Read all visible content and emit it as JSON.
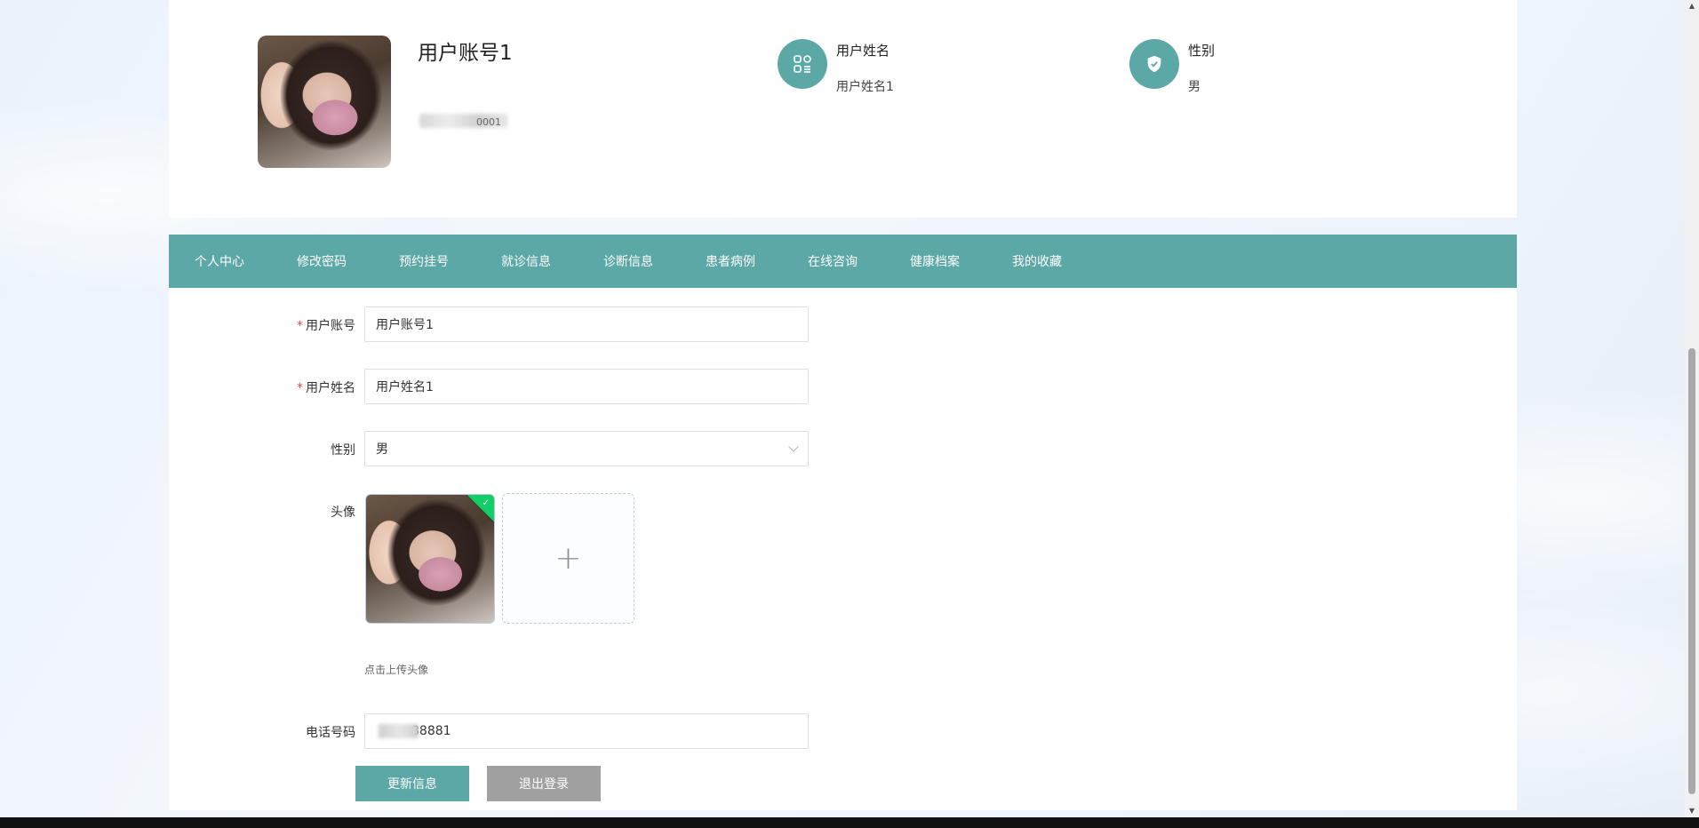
{
  "profile": {
    "account": "用户账号1",
    "phone_masked_tail": "0001",
    "info": [
      {
        "label": "用户姓名",
        "value": "用户姓名1",
        "icon": "user-card-icon"
      },
      {
        "label": "性别",
        "value": "男",
        "icon": "shield-check-icon"
      }
    ]
  },
  "tabs": [
    "个人中心",
    "修改密码",
    "预约挂号",
    "就诊信息",
    "诊断信息",
    "患者病例",
    "在线咨询",
    "健康档案",
    "我的收藏"
  ],
  "form": {
    "account_label": "用户账号",
    "account_value": "用户账号1",
    "name_label": "用户姓名",
    "name_value": "用户姓名1",
    "gender_label": "性别",
    "gender_value": "男",
    "avatar_label": "头像",
    "upload_hint": "点击上传头像",
    "phone_label": "电话号码",
    "phone_value": "88881",
    "required_mark": "*"
  },
  "buttons": {
    "update": "更新信息",
    "logout": "退出登录"
  },
  "colors": {
    "accent": "#5ba8a6",
    "secondary_button": "#a0a0a0",
    "success_badge": "#13ce66",
    "required": "#e04b4b"
  }
}
